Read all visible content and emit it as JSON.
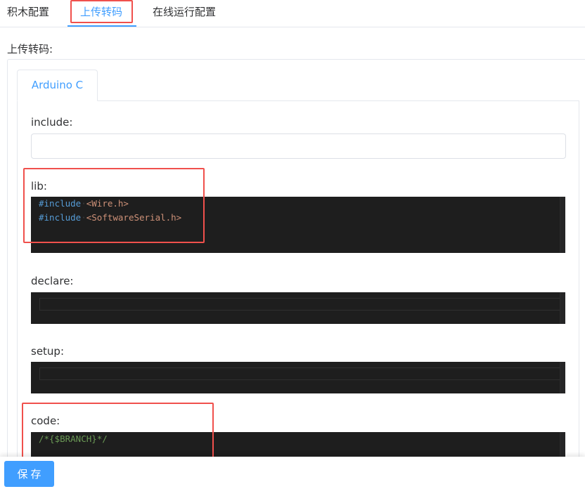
{
  "top_tabs": [
    {
      "label": "积木配置"
    },
    {
      "label": "上传转码"
    },
    {
      "label": "在线运行配置"
    }
  ],
  "section_label": "上传转码:",
  "inner_tab": {
    "label": "Arduino C"
  },
  "fields": {
    "include": {
      "label": "include:",
      "value": ""
    },
    "lib": {
      "label": "lib:",
      "lines": [
        {
          "directive": "#include",
          "header": "<Wire.h>"
        },
        {
          "directive": "#include",
          "header": "<SoftwareSerial.h>"
        }
      ]
    },
    "declare": {
      "label": "declare:"
    },
    "setup": {
      "label": "setup:"
    },
    "code": {
      "label": "code:",
      "lines": [
        "/*{$BRANCH}*/"
      ]
    }
  },
  "save_button": {
    "label": "保存"
  },
  "colors": {
    "accent": "#409eff",
    "highlight": "#f0504c",
    "editor_bg": "#1e1e1e",
    "keyword": "#569cd6",
    "string": "#ce9178",
    "comment": "#6a9955"
  }
}
